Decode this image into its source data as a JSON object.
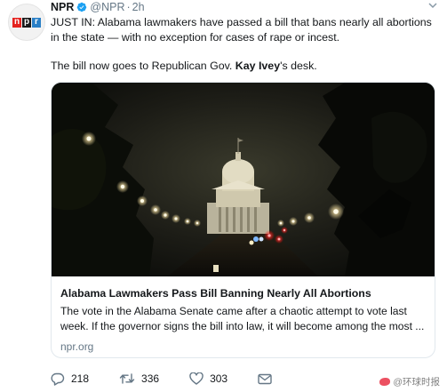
{
  "tweet": {
    "author_name": "NPR",
    "handle": "@NPR",
    "separator": "·",
    "time": "2h",
    "avatar_letters": [
      "n",
      "p",
      "r"
    ],
    "text_line1": "JUST IN: Alabama lawmakers have passed a bill that bans nearly all abortions in the state — with no exception for cases of rape or incest.",
    "text_line2_before": "The bill now goes to Republican Gov.",
    "text_line2_mention": "Kay Ivey",
    "text_line2_after": "'s desk."
  },
  "card": {
    "title": "Alabama Lawmakers Pass Bill Banning Nearly All Abortions",
    "description": "The vote in the Alabama Senate came after a chaotic attempt to vote last week. If the governor signs the bill into law, it will become among the most ...",
    "domain": "npr.org"
  },
  "actions": {
    "replies": "218",
    "retweets": "336",
    "likes": "303"
  },
  "watermark": {
    "text": "@环球时报"
  },
  "colors": {
    "npr_red": "#e4231f",
    "npr_black": "#1a1a1a",
    "npr_blue": "#2a7fc6",
    "verified_blue": "#1da1f2",
    "secondary_text": "#657786"
  },
  "icons": {
    "verified": "verified-badge-icon",
    "caret": "chevron-down-icon",
    "reply": "reply-icon",
    "retweet": "retweet-icon",
    "like": "heart-icon",
    "dm": "envelope-icon"
  }
}
